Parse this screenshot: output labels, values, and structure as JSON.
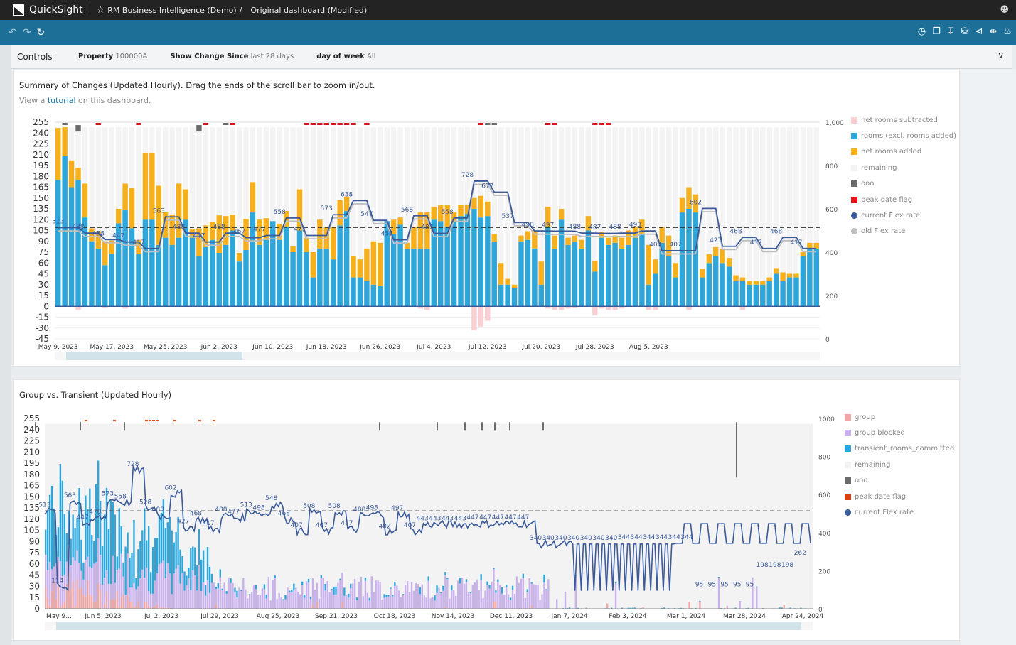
{
  "app": {
    "name": "QuickSight",
    "breadcrumb": [
      "RM Business Intelligence (Demo)",
      "/",
      "Original dashboard (Modified)"
    ]
  },
  "toolbar": {
    "left_icons": [
      "undo-icon",
      "redo-icon",
      "reset-icon"
    ],
    "right_icons": [
      "clock-icon",
      "bookmark-icon",
      "download-icon",
      "database-icon",
      "share-icon",
      "fit-width-icon",
      "bell-icon"
    ]
  },
  "controls": {
    "title": "Controls",
    "items": [
      {
        "label": "Property",
        "value": "100000A"
      },
      {
        "label": "Show Change Since",
        "value": "last 28 days"
      },
      {
        "label": "day of week",
        "value": "All"
      }
    ]
  },
  "colors": {
    "blue": "#2ea6d9",
    "orange": "#f6b01e",
    "pink": "#f9cfd3",
    "remaining": "#f4f4f4",
    "ooo": "#6b6b6b",
    "peak": "#d8141c",
    "flex": "#3a5a9a",
    "oldflex": "#bdbdbd",
    "group": "#f0a8a0",
    "groupBlocked": "#cdb0e8",
    "peak2": "#d9400f"
  },
  "panel1": {
    "title": "Summary of Changes (Updated Hourly). Drag the ends of the scroll bar to zoom in/out.",
    "subtitle_pre": "View a ",
    "subtitle_link": "tutorial",
    "subtitle_post": " on this dashboard.",
    "legend": [
      {
        "label": "net rooms subtracted",
        "color": "#f9cfd3",
        "shape": "square"
      },
      {
        "label": "rooms (excl. rooms added)",
        "color": "#2ea6d9",
        "shape": "square"
      },
      {
        "label": "net rooms added",
        "color": "#f6b01e",
        "shape": "square"
      },
      {
        "label": "remaining",
        "color": "#f2f2f2",
        "shape": "square"
      },
      {
        "label": "ooo",
        "color": "#6b6b6b",
        "shape": "square"
      },
      {
        "label": "peak date flag",
        "color": "#e0141c",
        "shape": "square"
      },
      {
        "label": "current Flex rate",
        "color": "#3a5a9a",
        "shape": "circle"
      },
      {
        "label": "old Flex rate",
        "color": "#bdbdbd",
        "shape": "circle"
      }
    ]
  },
  "panel2": {
    "title": "Group vs. Transient (Updated Hourly)",
    "legend": [
      {
        "label": "group",
        "color": "#eea6a6",
        "shape": "square"
      },
      {
        "label": "group blocked",
        "color": "#c9b1ec",
        "shape": "square"
      },
      {
        "label": "transient_rooms_committed",
        "color": "#2ea6d9",
        "shape": "square"
      },
      {
        "label": "remaining",
        "color": "#f2f2f2",
        "shape": "square"
      },
      {
        "label": "ooo",
        "color": "#6b6b6b",
        "shape": "square"
      },
      {
        "label": "peak date flag",
        "color": "#d9400f",
        "shape": "square"
      },
      {
        "label": "current Flex rate",
        "color": "#3a5a9a",
        "shape": "circle"
      }
    ]
  },
  "chart_data": [
    {
      "type": "bar",
      "title": "Summary of Changes (Updated Hourly)",
      "stacked": true,
      "y_left": {
        "ticks": [
          255,
          240,
          225,
          210,
          195,
          180,
          165,
          150,
          135,
          120,
          105,
          90,
          75,
          60,
          45,
          30,
          15,
          0,
          -15,
          -30,
          -45
        ],
        "range": [
          -45,
          255
        ]
      },
      "y_right": {
        "ticks": [
          "1,000",
          "800",
          "600",
          "400",
          "200",
          "0"
        ],
        "range": [
          0,
          1000
        ]
      },
      "x_tick_labels": [
        "May 9, 2023",
        "May 17, 2023",
        "May 25, 2023",
        "Jun 2, 2023",
        "Jun 10, 2023",
        "Jun 18, 2023",
        "Jun 26, 2023",
        "Jul 4, 2023",
        "Jul 12, 2023",
        "Jul 20, 2023",
        "Jul 28, 2023",
        "Aug 5, 2023"
      ],
      "start_date": "May 9, 2023",
      "rooms": [
        175,
        208,
        165,
        175,
        123,
        90,
        80,
        57,
        73,
        115,
        133,
        108,
        72,
        120,
        120,
        85,
        95,
        85,
        95,
        120,
        95,
        70,
        82,
        92,
        74,
        85,
        105,
        62,
        78,
        130,
        85,
        92,
        118,
        92,
        110,
        75,
        105,
        75,
        40,
        80,
        80,
        65,
        112,
        132,
        40,
        40,
        35,
        30,
        28,
        118,
        100,
        113,
        80,
        80,
        80,
        80,
        120,
        118,
        110,
        118,
        125,
        128,
        135,
        123,
        125,
        90,
        30,
        30,
        25,
        90,
        92,
        80,
        30,
        110,
        80,
        120,
        85,
        90,
        80,
        105,
        48,
        95,
        85,
        88,
        80,
        85,
        95,
        100,
        30,
        45,
        88,
        70,
        40,
        130,
        135,
        130,
        40,
        60,
        70,
        60,
        55,
        35,
        35,
        30,
        30,
        30,
        35,
        45,
        35,
        40,
        40,
        70,
        80,
        80
      ],
      "net_added": [
        72,
        40,
        37,
        17,
        47,
        18,
        24,
        33,
        18,
        20,
        37,
        56,
        20,
        92,
        92,
        82,
        35,
        42,
        75,
        42,
        12,
        38,
        30,
        25,
        52,
        40,
        22,
        12,
        43,
        42,
        35,
        30,
        0,
        22,
        22,
        8,
        57,
        20,
        35,
        40,
        30,
        45,
        35,
        20,
        30,
        25,
        45,
        60,
        60,
        0,
        20,
        10,
        8,
        30,
        50,
        50,
        18,
        22,
        30,
        12,
        15,
        13,
        15,
        30,
        20,
        10,
        30,
        8,
        5,
        8,
        12,
        25,
        32,
        28,
        18,
        15,
        10,
        8,
        12,
        20,
        15,
        8,
        10,
        10,
        15,
        20,
        15,
        20,
        55,
        20,
        22,
        28,
        20,
        20,
        30,
        25,
        12,
        12,
        12,
        20,
        12,
        8,
        5,
        5,
        5,
        5,
        5,
        8,
        12,
        5,
        5,
        5,
        8,
        8
      ],
      "net_subtracted": [
        0,
        0,
        0,
        -5,
        0,
        0,
        0,
        -2,
        0,
        0,
        -3,
        0,
        0,
        0,
        0,
        0,
        0,
        0,
        0,
        0,
        0,
        0,
        0,
        0,
        0,
        0,
        0,
        0,
        0,
        0,
        0,
        0,
        0,
        0,
        0,
        0,
        0,
        0,
        0,
        0,
        0,
        0,
        0,
        0,
        0,
        0,
        0,
        0,
        0,
        0,
        0,
        0,
        0,
        0,
        -3,
        -5,
        0,
        0,
        0,
        0,
        0,
        0,
        -33,
        -28,
        -20,
        0,
        0,
        0,
        0,
        0,
        0,
        0,
        0,
        -3,
        -5,
        -5,
        -3,
        -2,
        0,
        0,
        -12,
        -3,
        -5,
        -5,
        -3,
        0,
        0,
        0,
        -5,
        -5,
        0,
        0,
        0,
        0,
        -5,
        0,
        0,
        0,
        0,
        0,
        0,
        0,
        -5,
        0,
        0,
        0,
        0,
        0,
        0,
        0,
        0,
        0,
        0
      ],
      "current_flex_labels": [
        513,
        488,
        458,
        447,
        417,
        563,
        488,
        447,
        488,
        467,
        477,
        558,
        477,
        573,
        638,
        547,
        457,
        568,
        487,
        558,
        728,
        677,
        537,
        498,
        497,
        488,
        487,
        488,
        498,
        407,
        407,
        602,
        427,
        468,
        417,
        468,
        417
      ],
      "reference_line": 514,
      "series_names": [
        "net rooms subtracted",
        "rooms (excl. rooms added)",
        "net rooms added",
        "remaining",
        "ooo",
        "peak date flag",
        "current Flex rate",
        "old Flex rate"
      ]
    },
    {
      "type": "bar",
      "title": "Group vs. Transient (Updated Hourly)",
      "stacked": true,
      "y_left": {
        "ticks": [
          255,
          240,
          225,
          210,
          195,
          180,
          165,
          150,
          135,
          120,
          105,
          90,
          75,
          60,
          45,
          30,
          15,
          0
        ],
        "range": [
          0,
          255
        ]
      },
      "y_right": {
        "ticks": [
          "1000",
          "800",
          "600",
          "400",
          "200",
          "0"
        ],
        "range": [
          0,
          1000
        ]
      },
      "x_tick_labels": [
        "May 9...",
        "Jun 5, 2023",
        "Jul 2, 2023",
        "Jul 29, 2023",
        "Aug 25, 2023",
        "Sep 21, 2023",
        "Oct 18, 2023",
        "Nov 14, 2023",
        "Dec 11, 2023",
        "Jan 7, 2024",
        "Feb 3, 2024",
        "Mar 1, 2024",
        "Mar 28, 2024",
        "Apr 24, 2024"
      ],
      "current_flex_labels": [
        513,
        114,
        563,
        447,
        478,
        573,
        558,
        728,
        528,
        488,
        602,
        427,
        468,
        417,
        488,
        477,
        513,
        498,
        548,
        468,
        407,
        508,
        407,
        508,
        417,
        488,
        498,
        402,
        497,
        407,
        443,
        443,
        443,
        443,
        447,
        447,
        447,
        447,
        447,
        340,
        340,
        340,
        340,
        340,
        340,
        340,
        344,
        344,
        344,
        344,
        344,
        344,
        95,
        95,
        95,
        95,
        95,
        198,
        198,
        198,
        262
      ],
      "reference_line": 514,
      "series_names": [
        "group",
        "group blocked",
        "transient_rooms_committed",
        "remaining",
        "ooo",
        "peak date flag",
        "current Flex rate"
      ]
    }
  ]
}
